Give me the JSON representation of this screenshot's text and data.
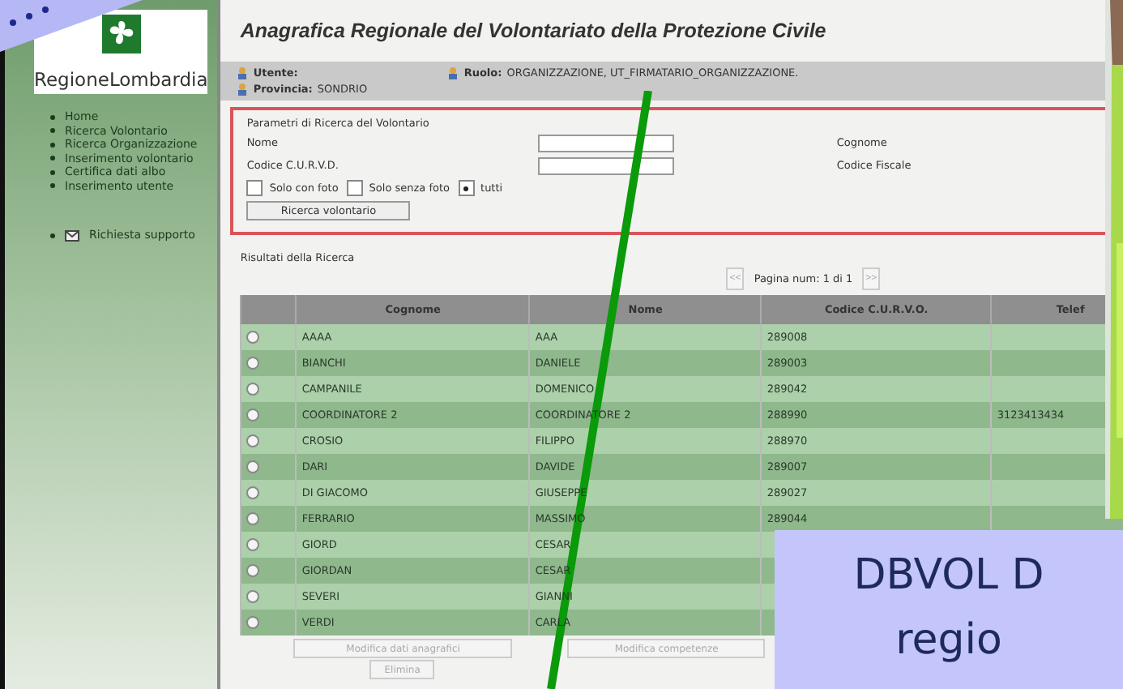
{
  "sidebar": {
    "logo_text": "RegioneLombardia",
    "menu": [
      "Home",
      "Ricerca Volontario",
      "Ricerca Organizzazione",
      "Inserimento volontario",
      "Certifica dati albo",
      "Inserimento utente"
    ],
    "support": "Richiesta supporto"
  },
  "header": {
    "title": "Anagrafica Regionale del Volontariato della Protezione Civile",
    "user_label": "Utente:",
    "role_label": "Ruolo:",
    "role_value": "ORGANIZZAZIONE, UT_FIRMATARIO_ORGANIZZAZIONE.",
    "province_label": "Provincia:",
    "province_value": "SONDRIO"
  },
  "search": {
    "legend": "Parametri di Ricerca del Volontario",
    "fields": [
      {
        "label": "Nome"
      },
      {
        "label": "Codice C.U.R.V.D."
      }
    ],
    "right_labels": [
      "Cognome",
      "Codice Fiscale"
    ],
    "photo_filter": [
      {
        "label": "Solo con foto",
        "selected": false
      },
      {
        "label": "Solo senza foto",
        "selected": false
      },
      {
        "label": "tutti",
        "selected": true
      }
    ],
    "button": "Ricerca volontario"
  },
  "results": {
    "title": "Risultati della Ricerca",
    "prev": "<<",
    "page": "Pagina num: 1 di 1",
    "next": ">>",
    "columns": [
      "Cognome",
      "Nome",
      "Codice C.U.R.V.O.",
      "Telef"
    ],
    "rows": [
      {
        "selected": false,
        "cells": [
          "AAAA",
          "AAA",
          "289008",
          ""
        ]
      },
      {
        "selected": false,
        "cells": [
          "BIANCHI",
          "DANIELE",
          "289003",
          ""
        ]
      },
      {
        "selected": false,
        "cells": [
          "CAMPANILE",
          "DOMENICO",
          "289042",
          ""
        ]
      },
      {
        "selected": false,
        "cells": [
          "COORDINATORE 2",
          "COORDINATORE 2",
          "288990",
          "3123413434"
        ]
      },
      {
        "selected": false,
        "cells": [
          "CROSIO",
          "FILIPPO",
          "288970",
          ""
        ]
      },
      {
        "selected": false,
        "cells": [
          "DARI",
          "DAVIDE",
          "289007",
          ""
        ]
      },
      {
        "selected": false,
        "cells": [
          "DI GIACOMO",
          "GIUSEPPE",
          "289027",
          ""
        ]
      },
      {
        "selected": false,
        "cells": [
          "FERRARIO",
          "MASSIMO",
          "289044",
          ""
        ]
      },
      {
        "selected": false,
        "cells": [
          "GIORD",
          "CESAR",
          "",
          ""
        ]
      },
      {
        "selected": false,
        "cells": [
          "GIORDAN",
          "CESAR",
          "",
          ""
        ]
      },
      {
        "selected": false,
        "cells": [
          "SEVERI",
          "GIANNI",
          "",
          ""
        ]
      },
      {
        "selected": false,
        "cells": [
          "VERDI",
          "CARLA",
          "",
          ""
        ]
      }
    ],
    "buttons": [
      "Modifica dati anagrafici",
      "Modifica competenze"
    ],
    "delete": "Elimina"
  },
  "callout": {
    "lines": [
      "DBVOL D",
      "regio"
    ]
  }
}
